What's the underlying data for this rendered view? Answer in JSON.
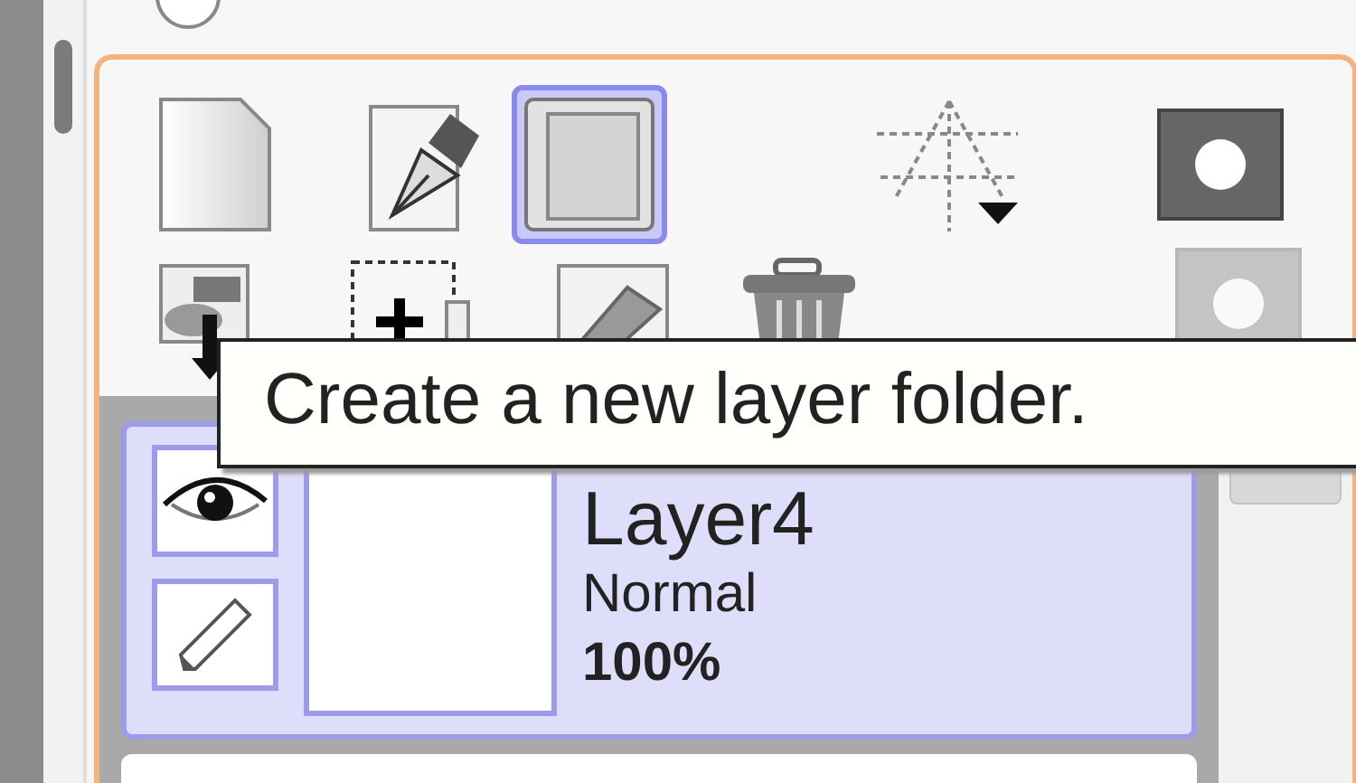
{
  "toolbar_rows": [
    [
      {
        "kind": "page",
        "selected": false,
        "disabled": false
      },
      {
        "kind": "pen",
        "selected": false,
        "disabled": false
      },
      {
        "kind": "folder",
        "selected": true,
        "disabled": false
      },
      {
        "kind": "ruler",
        "selected": false,
        "disabled": false
      },
      {
        "kind": "mask",
        "selected": false,
        "disabled": false
      }
    ],
    [
      {
        "kind": "merge",
        "selected": false,
        "disabled": false
      },
      {
        "kind": "copy",
        "selected": false,
        "disabled": false
      },
      {
        "kind": "eraser",
        "selected": false,
        "disabled": false
      },
      {
        "kind": "trash",
        "selected": false,
        "disabled": false
      },
      {
        "kind": "mask",
        "selected": false,
        "disabled": true
      }
    ]
  ],
  "tooltip": "Create a new layer folder.",
  "layers": [
    {
      "name": "Layer4",
      "blend_mode": "Normal",
      "opacity": "100%",
      "selected": true,
      "visible": true
    }
  ]
}
